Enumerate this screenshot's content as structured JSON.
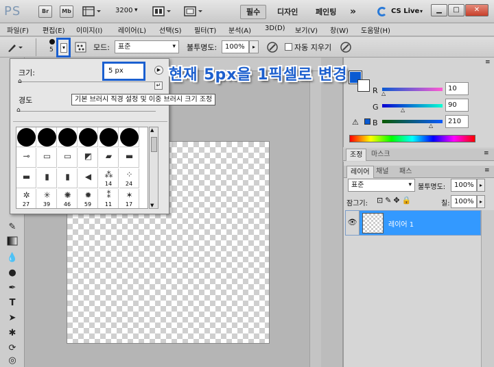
{
  "app": {
    "logo": "PS",
    "br_label": "Br",
    "mb_label": "Mb",
    "zoom_value": "3200",
    "workspaces": [
      "필수",
      "디자인",
      "페인팅"
    ],
    "more": "»",
    "cslive": "CS Live",
    "window_buttons": [
      "▁",
      "□",
      "✕"
    ]
  },
  "menu": [
    "파일(F)",
    "편집(E)",
    "이미지(I)",
    "레이어(L)",
    "선택(S)",
    "필터(T)",
    "분석(A)",
    "3D(D)",
    "보기(V)",
    "창(W)",
    "도움말(H)"
  ],
  "options": {
    "brush_size_small": "5",
    "mode_label": "모드:",
    "mode_value": "표준",
    "opacity_label": "불투명도:",
    "opacity_value": "100%",
    "auto_erase_label": "자동 지우기"
  },
  "popup": {
    "size_label": "크기:",
    "size_value": "5 px",
    "hardness_label": "경도",
    "tooltip": "기본 브러시 직경 설정 및 이중 브러시 크기 조정",
    "brush_numbers": [
      "14",
      "24",
      "27",
      "39",
      "46",
      "59",
      "11",
      "17"
    ]
  },
  "annotation": "현재 5px을 1픽셀로 변경",
  "color_panel": {
    "r_label": "R",
    "g_label": "G",
    "b_label": "B",
    "r_value": "10",
    "g_value": "90",
    "b_value": "210",
    "foreground": "#0a5ad2"
  },
  "adjust_tabs": [
    "조정",
    "마스크"
  ],
  "layers": {
    "tabs": [
      "레이어",
      "채널",
      "패스"
    ],
    "blend_mode": "표준",
    "opacity_label": "불투명도:",
    "opacity_value": "100%",
    "lock_label": "잠그기:",
    "fill_label": "칠:",
    "fill_value": "100%",
    "layer_name": "레이어 1",
    "selected_color": "#3399ff"
  },
  "colors": {
    "annotation_blue": "#1c5fce",
    "highlight_blue": "#1a5fd0"
  }
}
